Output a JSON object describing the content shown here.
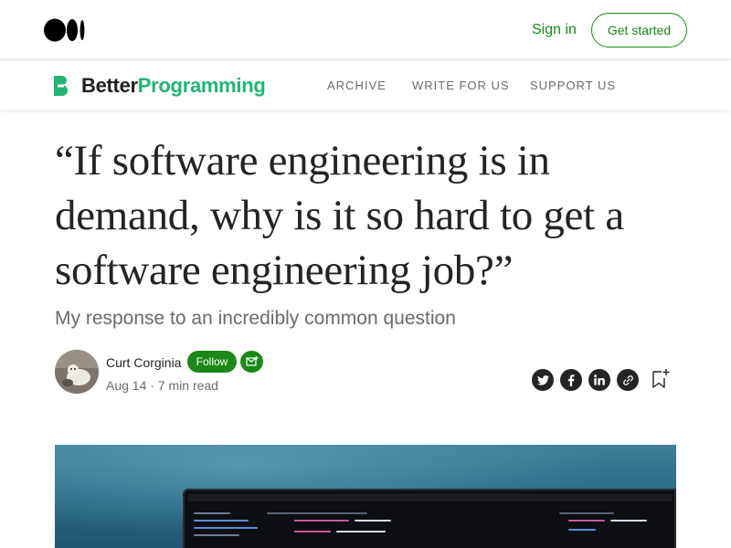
{
  "topbar": {
    "signin_label": "Sign in",
    "getstarted_label": "Get started"
  },
  "publication": {
    "name_part1": "Better",
    "name_part2": "Programming",
    "nav": [
      {
        "label": "ARCHIVE"
      },
      {
        "label": "WRITE FOR US"
      },
      {
        "label": "SUPPORT US"
      }
    ]
  },
  "article": {
    "title": "“If software engineering is in demand, why is it so hard to get a software engineering job?”",
    "subtitle": "My response to an incredibly common question",
    "author": "Curt Corginia",
    "follow_label": "Follow",
    "date": "Aug 14",
    "separator": "·",
    "read_time": "7 min read"
  },
  "colors": {
    "brand_green": "#1a8917",
    "publication_green": "#21b573",
    "text": "#242424",
    "muted": "#6b6b6b"
  },
  "icons": {
    "logo": "medium-logo",
    "subscribe": "envelope-plus-icon",
    "share": [
      "twitter-icon",
      "facebook-icon",
      "linkedin-icon",
      "link-icon"
    ],
    "bookmark": "bookmark-plus-icon"
  }
}
